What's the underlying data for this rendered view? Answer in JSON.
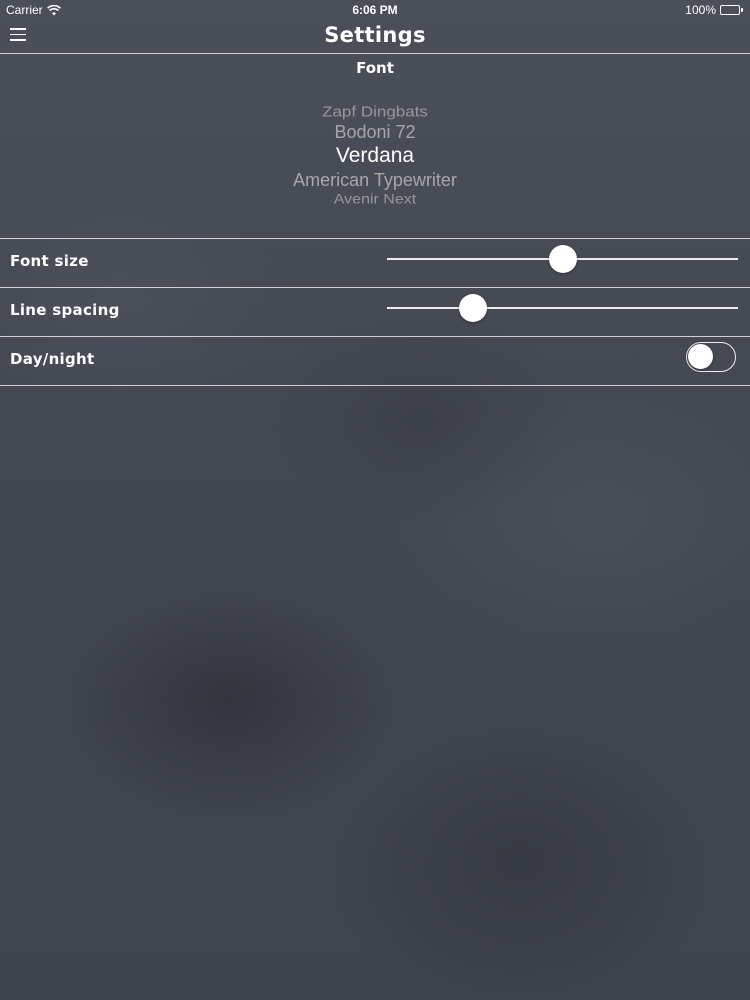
{
  "status_bar": {
    "carrier": "Carrier",
    "time": "6:06 PM",
    "battery": "100%",
    "battery_level": 1.0
  },
  "nav": {
    "title": "Settings",
    "menu_icon": "hamburger-menu-icon"
  },
  "font_section": {
    "header": "Font",
    "picker_items": [
      {
        "label": "",
        "state": "far-top"
      },
      {
        "label": "Zapf Dingbats",
        "state": "top"
      },
      {
        "label": "Bodoni 72",
        "state": "upper"
      },
      {
        "label": "Verdana",
        "state": "selected"
      },
      {
        "label": "American Typewriter",
        "state": "lower"
      },
      {
        "label": "Avenir Next",
        "state": "bottom"
      }
    ],
    "selected_font": "Verdana"
  },
  "settings": {
    "font_size": {
      "label": "Font size",
      "value": 0.5
    },
    "line_spacing": {
      "label": "Line spacing",
      "value": 0.245
    },
    "day_night": {
      "label": "Day/night",
      "on": false
    }
  },
  "colors": {
    "background": "#454952",
    "foreground": "#ffffff",
    "divider": "#e6e6e6"
  }
}
